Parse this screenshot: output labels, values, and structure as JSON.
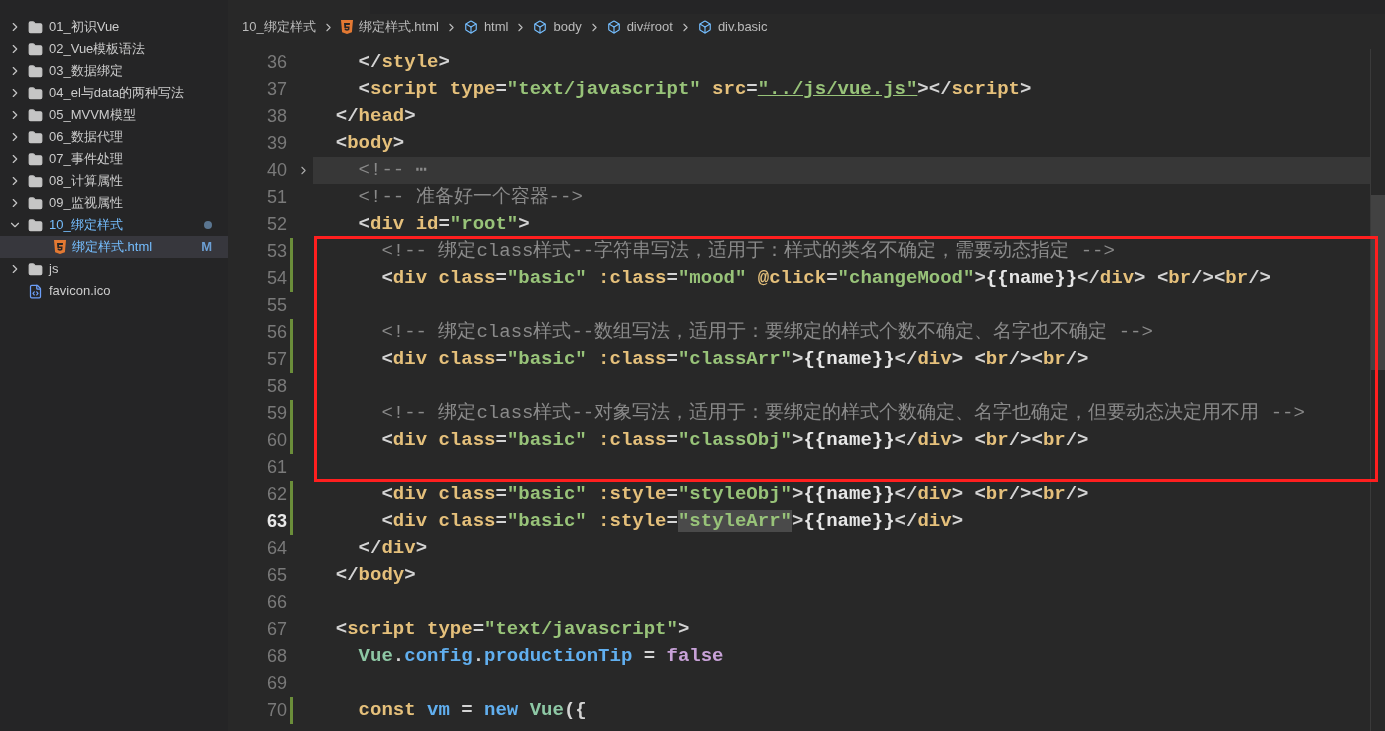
{
  "explorer": {
    "items": [
      {
        "label": "01_初识Vue",
        "kind": "folder",
        "expanded": false,
        "changed": false
      },
      {
        "label": "02_Vue模板语法",
        "kind": "folder",
        "expanded": false,
        "changed": false
      },
      {
        "label": "03_数据绑定",
        "kind": "folder",
        "expanded": false,
        "changed": false
      },
      {
        "label": "04_el与data的两种写法",
        "kind": "folder",
        "expanded": false,
        "changed": false
      },
      {
        "label": "05_MVVM模型",
        "kind": "folder",
        "expanded": false,
        "changed": false
      },
      {
        "label": "06_数据代理",
        "kind": "folder",
        "expanded": false,
        "changed": false
      },
      {
        "label": "07_事件处理",
        "kind": "folder",
        "expanded": false,
        "changed": false
      },
      {
        "label": "08_计算属性",
        "kind": "folder",
        "expanded": false,
        "changed": false
      },
      {
        "label": "09_监视属性",
        "kind": "folder",
        "expanded": false,
        "changed": false
      },
      {
        "label": "10_绑定样式",
        "kind": "folder",
        "expanded": true,
        "changed": true,
        "children": [
          {
            "label": "绑定样式.html",
            "kind": "html",
            "selected": true,
            "badge": "M"
          }
        ]
      },
      {
        "label": "js",
        "kind": "folder",
        "expanded": false,
        "changed": false
      },
      {
        "label": "favicon.ico",
        "kind": "file",
        "selected": false
      }
    ]
  },
  "breadcrumb": [
    {
      "label": "10_绑定样式",
      "kind": "folder"
    },
    {
      "label": "绑定样式.html",
      "kind": "html"
    },
    {
      "label": "html",
      "kind": "element"
    },
    {
      "label": "body",
      "kind": "element"
    },
    {
      "label": "div#root",
      "kind": "element"
    },
    {
      "label": "div.basic",
      "kind": "element"
    }
  ],
  "lines": [
    {
      "number": "36",
      "modified": false,
      "folded": false,
      "current": false,
      "tokens": [
        {
          "kind": "punct",
          "text": "    </"
        },
        {
          "kind": "tag",
          "text": "style"
        },
        {
          "kind": "punct",
          "text": ">"
        }
      ]
    },
    {
      "number": "37",
      "modified": false,
      "folded": false,
      "current": false,
      "tokens": [
        {
          "kind": "punct",
          "text": "    <"
        },
        {
          "kind": "tag",
          "text": "script"
        },
        {
          "kind": "attr",
          "text": " type"
        },
        {
          "kind": "punct",
          "text": "="
        },
        {
          "kind": "string",
          "text": "\"text/javascript\""
        },
        {
          "kind": "attr",
          "text": " src"
        },
        {
          "kind": "punct",
          "text": "="
        },
        {
          "kind": "link",
          "text": "\"../js/vue.js\""
        },
        {
          "kind": "punct",
          "text": "></"
        },
        {
          "kind": "tag",
          "text": "script"
        },
        {
          "kind": "punct",
          "text": ">"
        }
      ]
    },
    {
      "number": "38",
      "modified": false,
      "folded": false,
      "current": false,
      "tokens": [
        {
          "kind": "punct",
          "text": "  </"
        },
        {
          "kind": "tag",
          "text": "head"
        },
        {
          "kind": "punct",
          "text": ">"
        }
      ]
    },
    {
      "number": "39",
      "modified": false,
      "folded": false,
      "current": false,
      "tokens": [
        {
          "kind": "punct",
          "text": "  <"
        },
        {
          "kind": "tag",
          "text": "body"
        },
        {
          "kind": "punct",
          "text": ">"
        }
      ]
    },
    {
      "number": "40",
      "modified": false,
      "folded": true,
      "current": false,
      "tokens": [
        {
          "kind": "comment",
          "text": "    <!-- ⋯"
        }
      ]
    },
    {
      "number": "51",
      "modified": false,
      "folded": false,
      "current": false,
      "tokens": [
        {
          "kind": "comment",
          "text": "    <!-- 准备好一个容器-->"
        }
      ]
    },
    {
      "number": "52",
      "modified": false,
      "folded": false,
      "current": false,
      "tokens": [
        {
          "kind": "punct",
          "text": "    <"
        },
        {
          "kind": "tag",
          "text": "div"
        },
        {
          "kind": "attr",
          "text": " id"
        },
        {
          "kind": "punct",
          "text": "="
        },
        {
          "kind": "string",
          "text": "\"root\""
        },
        {
          "kind": "punct",
          "text": ">"
        }
      ]
    },
    {
      "number": "53",
      "modified": true,
      "folded": false,
      "current": false,
      "tokens": [
        {
          "kind": "comment",
          "text": "      <!-- 绑定class样式--字符串写法，适用于：样式的类名不确定，需要动态指定 -->"
        }
      ]
    },
    {
      "number": "54",
      "modified": true,
      "folded": false,
      "current": false,
      "tokens": [
        {
          "kind": "punct",
          "text": "      <"
        },
        {
          "kind": "tag",
          "text": "div"
        },
        {
          "kind": "attr",
          "text": " class"
        },
        {
          "kind": "punct",
          "text": "="
        },
        {
          "kind": "string",
          "text": "\"basic\""
        },
        {
          "kind": "attr",
          "text": " :class"
        },
        {
          "kind": "punct",
          "text": "="
        },
        {
          "kind": "string",
          "text": "\"mood\""
        },
        {
          "kind": "attr",
          "text": " @click"
        },
        {
          "kind": "punct",
          "text": "="
        },
        {
          "kind": "string",
          "text": "\"changeMood\""
        },
        {
          "kind": "punct",
          "text": ">"
        },
        {
          "kind": "text",
          "text": "{{name}}"
        },
        {
          "kind": "punct",
          "text": "</"
        },
        {
          "kind": "tag",
          "text": "div"
        },
        {
          "kind": "punct",
          "text": "> <"
        },
        {
          "kind": "tag",
          "text": "br"
        },
        {
          "kind": "punct",
          "text": "/><"
        },
        {
          "kind": "tag",
          "text": "br"
        },
        {
          "kind": "punct",
          "text": "/>"
        }
      ]
    },
    {
      "number": "55",
      "modified": false,
      "folded": false,
      "current": false
    },
    {
      "number": "56",
      "modified": true,
      "folded": false,
      "current": false,
      "tokens": [
        {
          "kind": "comment",
          "text": "      <!-- 绑定class样式--数组写法，适用于：要绑定的样式个数不确定、名字也不确定 -->"
        }
      ]
    },
    {
      "number": "57",
      "modified": true,
      "folded": false,
      "current": false,
      "tokens": [
        {
          "kind": "punct",
          "text": "      <"
        },
        {
          "kind": "tag",
          "text": "div"
        },
        {
          "kind": "attr",
          "text": " class"
        },
        {
          "kind": "punct",
          "text": "="
        },
        {
          "kind": "string",
          "text": "\"basic\""
        },
        {
          "kind": "attr",
          "text": " :class"
        },
        {
          "kind": "punct",
          "text": "="
        },
        {
          "kind": "string",
          "text": "\"classArr\""
        },
        {
          "kind": "punct",
          "text": ">"
        },
        {
          "kind": "text",
          "text": "{{name}}"
        },
        {
          "kind": "punct",
          "text": "</"
        },
        {
          "kind": "tag",
          "text": "div"
        },
        {
          "kind": "punct",
          "text": "> <"
        },
        {
          "kind": "tag",
          "text": "br"
        },
        {
          "kind": "punct",
          "text": "/><"
        },
        {
          "kind": "tag",
          "text": "br"
        },
        {
          "kind": "punct",
          "text": "/>"
        }
      ]
    },
    {
      "number": "58",
      "modified": false,
      "folded": false,
      "current": false
    },
    {
      "number": "59",
      "modified": true,
      "folded": false,
      "current": false,
      "tokens": [
        {
          "kind": "comment",
          "text": "      <!-- 绑定class样式--对象写法，适用于：要绑定的样式个数确定、名字也确定，但要动态决定用不用 -->"
        }
      ]
    },
    {
      "number": "60",
      "modified": true,
      "folded": false,
      "current": false,
      "tokens": [
        {
          "kind": "punct",
          "text": "      <"
        },
        {
          "kind": "tag",
          "text": "div"
        },
        {
          "kind": "attr",
          "text": " class"
        },
        {
          "kind": "punct",
          "text": "="
        },
        {
          "kind": "string",
          "text": "\"basic\""
        },
        {
          "kind": "attr",
          "text": " :class"
        },
        {
          "kind": "punct",
          "text": "="
        },
        {
          "kind": "string",
          "text": "\"classObj\""
        },
        {
          "kind": "punct",
          "text": ">"
        },
        {
          "kind": "text",
          "text": "{{name}}"
        },
        {
          "kind": "punct",
          "text": "</"
        },
        {
          "kind": "tag",
          "text": "div"
        },
        {
          "kind": "punct",
          "text": "> <"
        },
        {
          "kind": "tag",
          "text": "br"
        },
        {
          "kind": "punct",
          "text": "/><"
        },
        {
          "kind": "tag",
          "text": "br"
        },
        {
          "kind": "punct",
          "text": "/>"
        }
      ]
    },
    {
      "number": "61",
      "modified": false,
      "folded": false,
      "current": false
    },
    {
      "number": "62",
      "modified": true,
      "folded": false,
      "current": false,
      "tokens": [
        {
          "kind": "punct",
          "text": "      <"
        },
        {
          "kind": "tag",
          "text": "div"
        },
        {
          "kind": "attr",
          "text": " class"
        },
        {
          "kind": "punct",
          "text": "="
        },
        {
          "kind": "string",
          "text": "\"basic\""
        },
        {
          "kind": "attr",
          "text": " :style"
        },
        {
          "kind": "punct",
          "text": "="
        },
        {
          "kind": "string",
          "text": "\"styleObj\""
        },
        {
          "kind": "punct",
          "text": ">"
        },
        {
          "kind": "text",
          "text": "{{name}}"
        },
        {
          "kind": "punct",
          "text": "</"
        },
        {
          "kind": "tag",
          "text": "div"
        },
        {
          "kind": "punct",
          "text": "> <"
        },
        {
          "kind": "tag",
          "text": "br"
        },
        {
          "kind": "punct",
          "text": "/><"
        },
        {
          "kind": "tag",
          "text": "br"
        },
        {
          "kind": "punct",
          "text": "/>"
        }
      ]
    },
    {
      "number": "63",
      "modified": true,
      "folded": false,
      "current": true,
      "tokens": [
        {
          "kind": "punct",
          "text": "      <"
        },
        {
          "kind": "tag",
          "text": "div"
        },
        {
          "kind": "attr",
          "text": " class"
        },
        {
          "kind": "punct",
          "text": "="
        },
        {
          "kind": "string",
          "text": "\"basic\""
        },
        {
          "kind": "attr",
          "text": " :style"
        },
        {
          "kind": "punct",
          "text": "="
        },
        {
          "kind": "string",
          "text": "\"styleArr\"",
          "highlighted": true
        },
        {
          "kind": "punct",
          "text": ">"
        },
        {
          "kind": "text",
          "text": "{{name}}"
        },
        {
          "kind": "punct",
          "text": "</"
        },
        {
          "kind": "tag",
          "text": "div"
        },
        {
          "kind": "punct",
          "text": ">"
        }
      ]
    },
    {
      "number": "64",
      "modified": false,
      "folded": false,
      "current": false,
      "tokens": [
        {
          "kind": "punct",
          "text": "    </"
        },
        {
          "kind": "tag",
          "text": "div"
        },
        {
          "kind": "punct",
          "text": ">"
        }
      ]
    },
    {
      "number": "65",
      "modified": false,
      "folded": false,
      "current": false,
      "tokens": [
        {
          "kind": "punct",
          "text": "  </"
        },
        {
          "kind": "tag",
          "text": "body"
        },
        {
          "kind": "punct",
          "text": ">"
        }
      ]
    },
    {
      "number": "66",
      "modified": false,
      "folded": false,
      "current": false
    },
    {
      "number": "67",
      "modified": false,
      "folded": false,
      "current": false,
      "tokens": [
        {
          "kind": "punct",
          "text": "  <"
        },
        {
          "kind": "tag",
          "text": "script"
        },
        {
          "kind": "attr",
          "text": " type"
        },
        {
          "kind": "punct",
          "text": "="
        },
        {
          "kind": "string",
          "text": "\"text/javascript\""
        },
        {
          "kind": "punct",
          "text": ">"
        }
      ]
    },
    {
      "number": "68",
      "modified": false,
      "folded": false,
      "current": false,
      "tokens": [
        {
          "kind": "class",
          "text": "    Vue"
        },
        {
          "kind": "punct",
          "text": "."
        },
        {
          "kind": "prop",
          "text": "config"
        },
        {
          "kind": "punct",
          "text": "."
        },
        {
          "kind": "prop",
          "text": "productionTip"
        },
        {
          "kind": "punct",
          "text": " = "
        },
        {
          "kind": "literal",
          "text": "false"
        }
      ]
    },
    {
      "number": "69",
      "modified": false,
      "folded": false,
      "current": false
    },
    {
      "number": "70",
      "modified": true,
      "folded": false,
      "current": false,
      "tokens": [
        {
          "kind": "keyword",
          "text": "    const"
        },
        {
          "kind": "prop",
          "text": " vm"
        },
        {
          "kind": "punct",
          "text": " = "
        },
        {
          "kind": "prop",
          "text": "new"
        },
        {
          "kind": "class",
          "text": " Vue"
        },
        {
          "kind": "punct",
          "text": "({"
        }
      ]
    }
  ]
}
